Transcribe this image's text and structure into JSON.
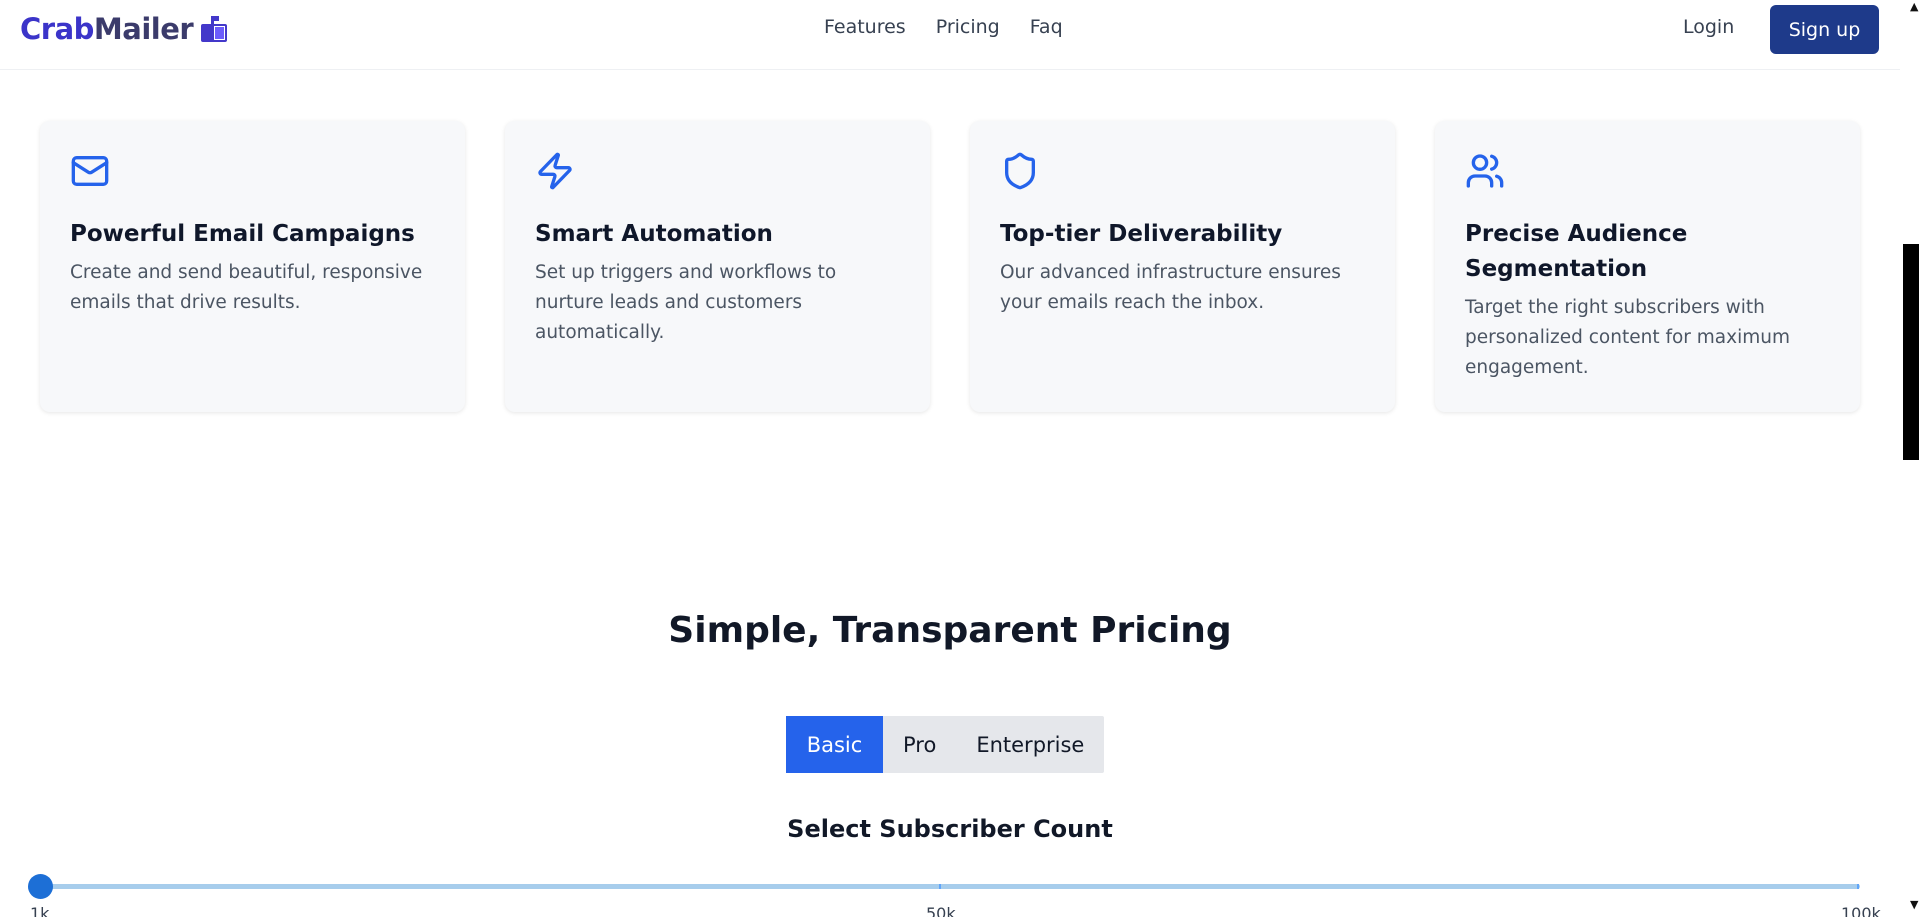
{
  "header": {
    "brand_part1": "Crab",
    "brand_part2": "Mailer",
    "nav": [
      "Features",
      "Pricing",
      "Faq"
    ],
    "login_label": "Login",
    "signup_label": "Sign up"
  },
  "features": [
    {
      "icon": "mail-icon",
      "title": "Powerful Email Campaigns",
      "description": "Create and send beautiful, responsive emails that drive results."
    },
    {
      "icon": "lightning-icon",
      "title": "Smart Automation",
      "description": "Set up triggers and workflows to nurture leads and customers automatically."
    },
    {
      "icon": "shield-icon",
      "title": "Top-tier Deliverability",
      "description": "Our advanced infrastructure ensures your emails reach the inbox."
    },
    {
      "icon": "users-icon",
      "title": "Precise Audience Segmentation",
      "description": "Target the right subscribers with personalized content for maximum engagement."
    }
  ],
  "pricing": {
    "title": "Simple, Transparent Pricing",
    "tabs": [
      "Basic",
      "Pro",
      "Enterprise"
    ],
    "active_tab": "Basic",
    "subscriber_title": "Select Subscriber Count",
    "slider": {
      "min_label": "1k",
      "mid_label": "50k",
      "max_label": "100k",
      "value_fraction": 0
    }
  },
  "colors": {
    "accent": "#2563eb",
    "brand": "#3b34c9",
    "signup_bg": "#1e3a8a"
  }
}
